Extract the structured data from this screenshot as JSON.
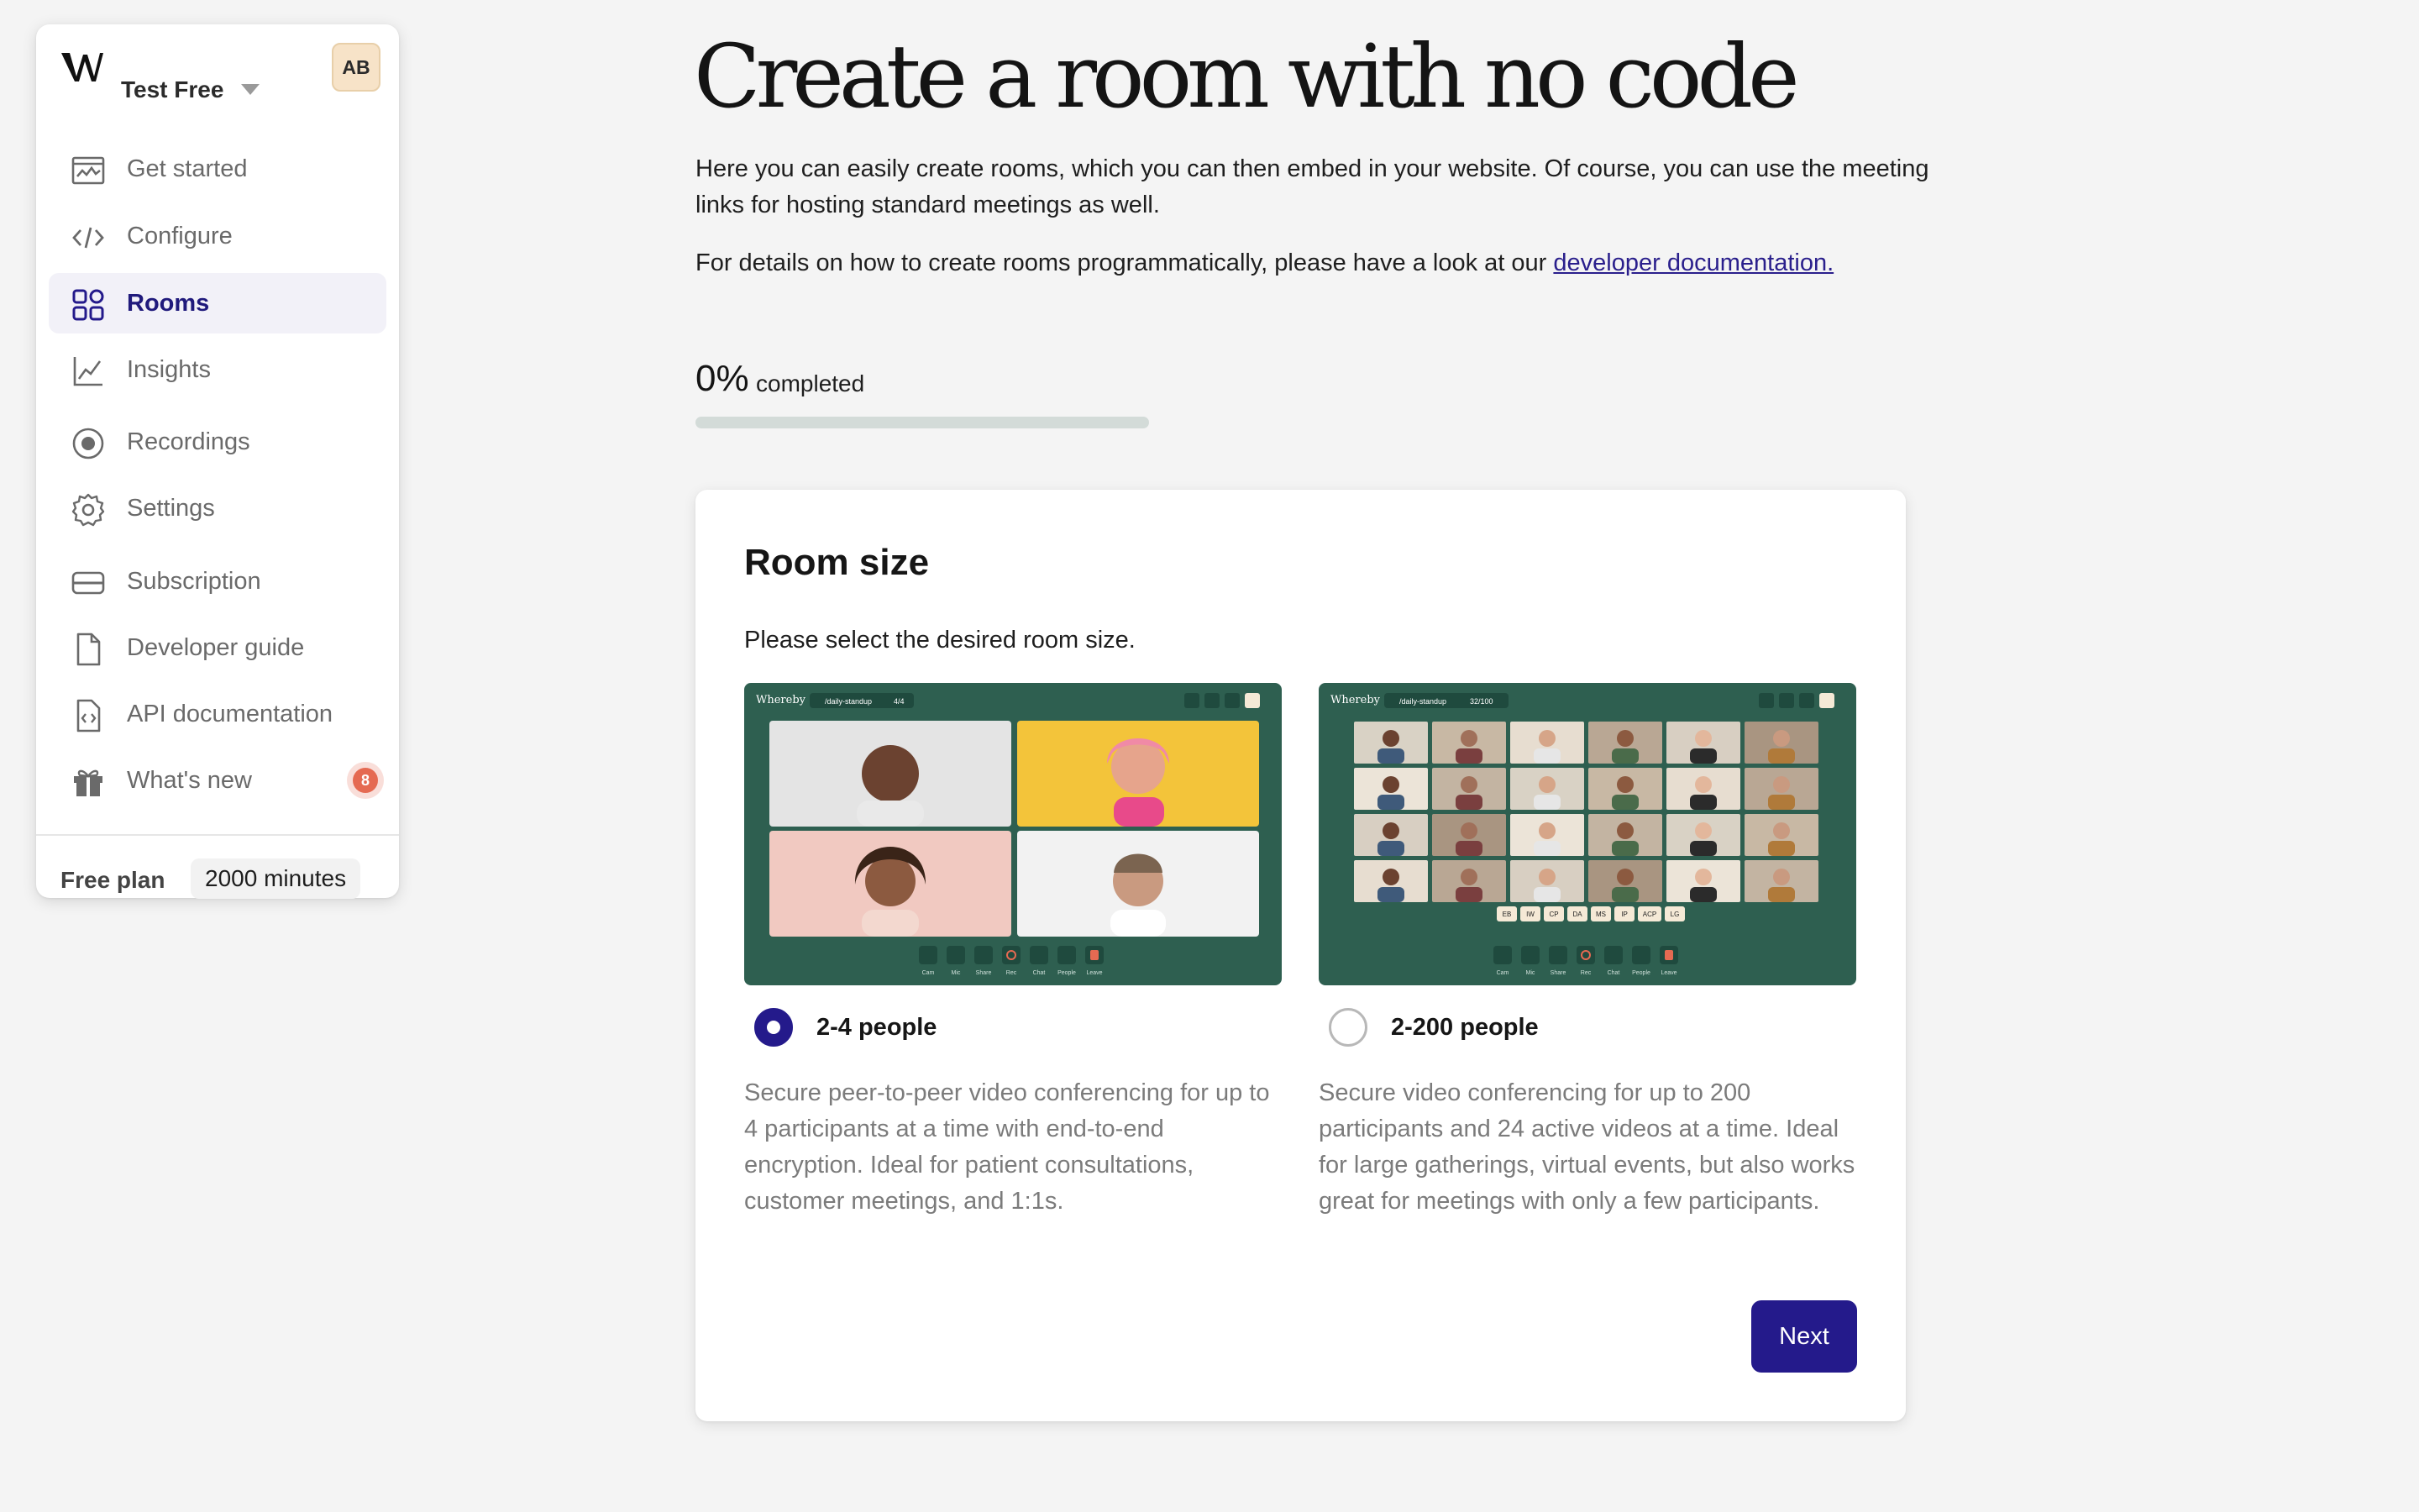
{
  "sidebar": {
    "team_name": "Test Free",
    "avatar_initials": "AB",
    "items": [
      {
        "label": "Get started",
        "icon": "chart-window-icon",
        "active": false
      },
      {
        "label": "Configure",
        "icon": "code-icon",
        "active": false
      },
      {
        "label": "Rooms",
        "icon": "grid-icon",
        "active": true
      },
      {
        "label": "Insights",
        "icon": "line-chart-icon",
        "active": false
      },
      {
        "label": "Recordings",
        "icon": "record-icon",
        "active": false
      },
      {
        "label": "Settings",
        "icon": "gear-icon",
        "active": false
      },
      {
        "label": "Subscription",
        "icon": "card-icon",
        "active": false
      },
      {
        "label": "Developer guide",
        "icon": "document-icon",
        "active": false
      },
      {
        "label": "API documentation",
        "icon": "code-document-icon",
        "active": false
      },
      {
        "label": "What's new",
        "icon": "gift-icon",
        "active": false,
        "badge": "8"
      }
    ],
    "plan_label": "Free plan",
    "minutes": "2000 minutes"
  },
  "main": {
    "title": "Create a room with no code",
    "intro": "Here you can easily create rooms, which you can then embed in your website. Of course, you can use the meeting links for hosting standard meetings as well.",
    "details_prefix": "For details on how to create rooms programmatically, please have a look at our ",
    "details_link": "developer documentation.",
    "progress": {
      "percent_text": "0%",
      "label": "completed",
      "value": 0
    }
  },
  "card": {
    "title": "Room size",
    "subtitle": "Please select the desired room size.",
    "options": [
      {
        "label": "2-4 people",
        "selected": true,
        "description": "Secure peer-to-peer video conferencing for up to 4 participants at a time with end-to-end encryption. Ideal for patient consultations, customer meetings, and 1:1s."
      },
      {
        "label": "2-200 people",
        "selected": false,
        "description": "Secure video conferencing for up to 200 participants and 24 active videos at a time. Ideal for large gatherings, virtual events, but also works great for meetings with only a few participants."
      }
    ],
    "next_label": "Next"
  },
  "preview": {
    "brand": "Whereby",
    "room_small": "/daily-standup",
    "count_small": "4/4",
    "room_large": "/daily-standup",
    "count_large": "32/100",
    "controls": [
      "Cam",
      "Mic",
      "Share",
      "Rec",
      "Chat",
      "People",
      "Leave"
    ],
    "tags": [
      "EB",
      "IW",
      "CP",
      "DA",
      "MS",
      "IP",
      "ACP",
      "LG"
    ]
  },
  "colors": {
    "accent": "#241a8b",
    "thumb_bg": "#2e5f50",
    "badge": "#e56a52"
  }
}
